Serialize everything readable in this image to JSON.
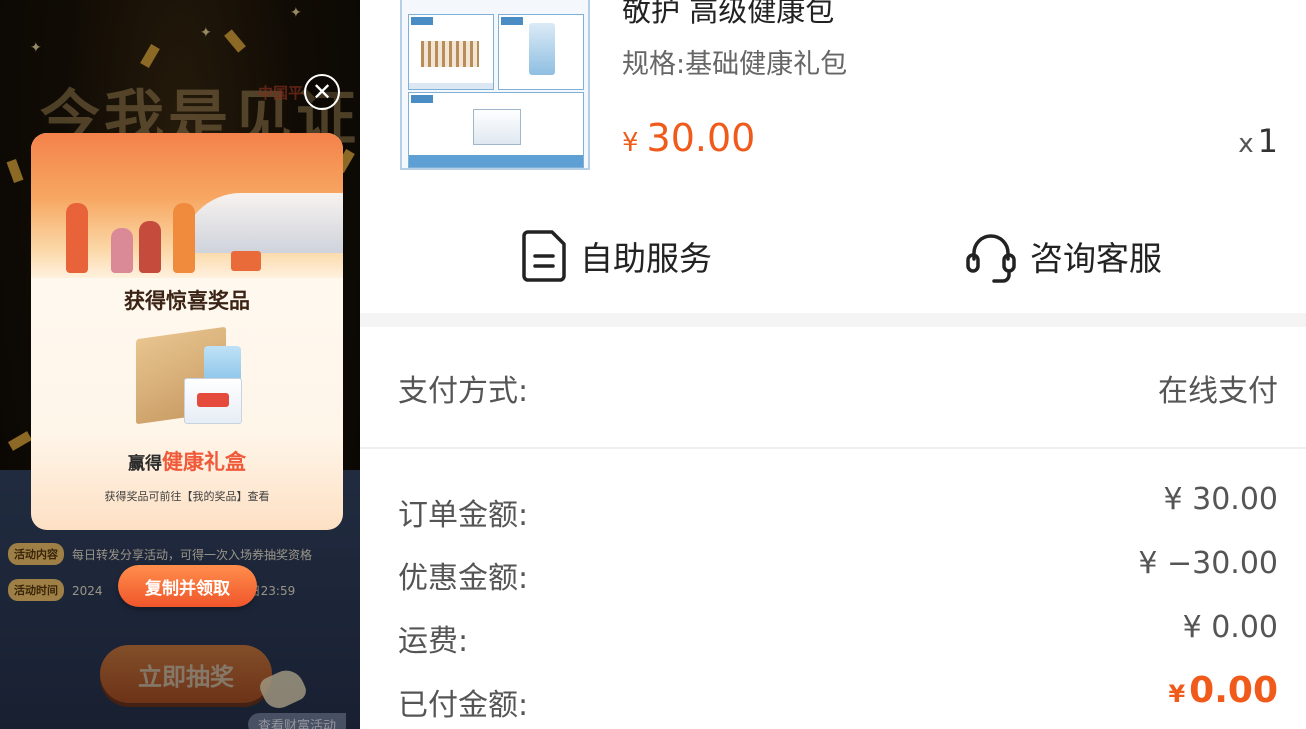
{
  "promo": {
    "hero_title": "今我是见证",
    "hero_logo": "中国平",
    "activity_rows": [
      {
        "tag": "活动内容",
        "text": "每日转发分享活动，可得一次入场券抽奖资格"
      },
      {
        "tag": "活动时间",
        "text": "2024                        年12月12日23:59"
      }
    ],
    "draw_button": "立即抽奖",
    "more_link": "查看财富活动"
  },
  "modal": {
    "title": "获得惊喜奖品",
    "win_prefix": "赢得",
    "win_highlight": "健康礼盒",
    "note": "获得奖品可前往【我的奖品】查看",
    "close_symbol": "✕",
    "claim_button": "复制并领取"
  },
  "product": {
    "name": "敬护 高级健康包",
    "spec": "规格:基础健康礼包",
    "currency": "¥",
    "price": "30.00",
    "qty_prefix": "x",
    "qty": "1"
  },
  "services": {
    "self_service": {
      "label": "自助服务",
      "icon": "document-icon"
    },
    "customer_service": {
      "label": "咨询客服",
      "icon": "headset-icon"
    }
  },
  "payment": {
    "method_label": "支付方式:",
    "method_value": "在线支付"
  },
  "summary": {
    "order_amount_label": "订单金额:",
    "order_amount_value": "¥ 30.00",
    "discount_label": "优惠金额:",
    "discount_value": "¥ −30.00",
    "shipping_label": "运费:",
    "shipping_value": "¥ 0.00",
    "paid_label": "已付金额:",
    "paid_currency": "¥",
    "paid_value": "0.00"
  },
  "colors": {
    "accent": "#f05a1a",
    "modal_highlight": "#f05a3a",
    "claim_button": "#f0562b"
  }
}
